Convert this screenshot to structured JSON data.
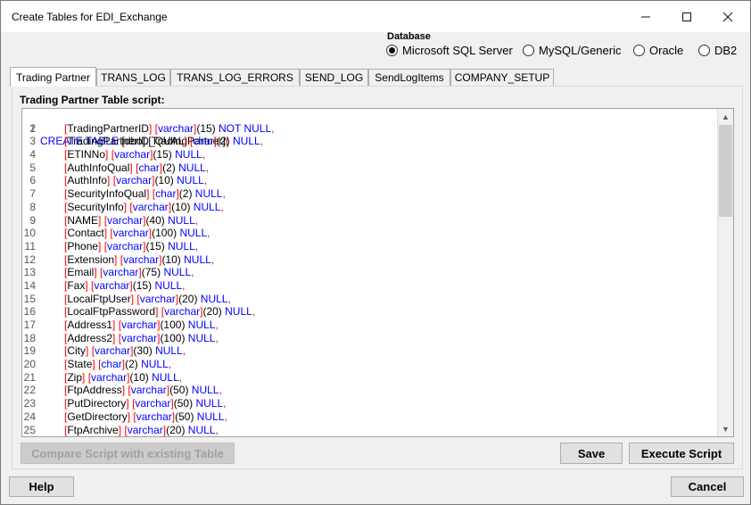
{
  "window": {
    "title": "Create Tables for EDI_Exchange",
    "minimize_icon": "minimize-icon",
    "maximize_icon": "maximize-icon",
    "close_icon": "close-icon"
  },
  "database": {
    "label": "Database",
    "options": [
      "Microsoft SQL Server",
      "MySQL/Generic",
      "Oracle",
      "DB2"
    ],
    "selected": "Microsoft SQL Server"
  },
  "tabs": [
    {
      "label": "Trading Partner",
      "active": true
    },
    {
      "label": "TRANS_LOG",
      "active": false
    },
    {
      "label": "TRANS_LOG_ERRORS",
      "active": false
    },
    {
      "label": "SEND_LOG",
      "active": false
    },
    {
      "label": "SendLogItems",
      "active": false
    },
    {
      "label": "COMPANY_SETUP",
      "active": false
    }
  ],
  "script_label": "Trading Partner Table script:",
  "script_header": {
    "kw": "CREATE TABLE",
    "schema": "[dbo]",
    "table": "[TradingPartner]",
    "paren": "("
  },
  "script_lines": [
    {
      "n": "2",
      "col": "TradingPartnerID",
      "type": "varchar",
      "size": "15",
      "nn": "NOT NULL"
    },
    {
      "n": "3",
      "col": "TradingPartnerID_QUAL",
      "type": "char",
      "size": "2",
      "nn": "NULL"
    },
    {
      "n": "4",
      "col": "ETINNo",
      "type": "varchar",
      "size": "15",
      "nn": "NULL"
    },
    {
      "n": "5",
      "col": "AuthInfoQual",
      "type": "char",
      "size": "2",
      "nn": "NULL"
    },
    {
      "n": "6",
      "col": "AuthInfo",
      "type": "varchar",
      "size": "10",
      "nn": "NULL"
    },
    {
      "n": "7",
      "col": "SecurityInfoQual",
      "type": "char",
      "size": "2",
      "nn": "NULL"
    },
    {
      "n": "8",
      "col": "SecurityInfo",
      "type": "varchar",
      "size": "10",
      "nn": "NULL"
    },
    {
      "n": "9",
      "col": "NAME",
      "type": "varchar",
      "size": "40",
      "nn": "NULL"
    },
    {
      "n": "10",
      "col": "Contact",
      "type": "varchar",
      "size": "100",
      "nn": "NULL"
    },
    {
      "n": "11",
      "col": "Phone",
      "type": "varchar",
      "size": "15",
      "nn": "NULL"
    },
    {
      "n": "12",
      "col": "Extension",
      "type": "varchar",
      "size": "10",
      "nn": "NULL"
    },
    {
      "n": "13",
      "col": "Email",
      "type": "varchar",
      "size": "75",
      "nn": "NULL"
    },
    {
      "n": "14",
      "col": "Fax",
      "type": "varchar",
      "size": "15",
      "nn": "NULL"
    },
    {
      "n": "15",
      "col": "LocalFtpUser",
      "type": "varchar",
      "size": "20",
      "nn": "NULL"
    },
    {
      "n": "16",
      "col": "LocalFtpPassword",
      "type": "varchar",
      "size": "20",
      "nn": "NULL"
    },
    {
      "n": "17",
      "col": "Address1",
      "type": "varchar",
      "size": "100",
      "nn": "NULL"
    },
    {
      "n": "18",
      "col": "Address2",
      "type": "varchar",
      "size": "100",
      "nn": "NULL"
    },
    {
      "n": "19",
      "col": "City",
      "type": "varchar",
      "size": "30",
      "nn": "NULL"
    },
    {
      "n": "20",
      "col": "State",
      "type": "char",
      "size": "2",
      "nn": "NULL"
    },
    {
      "n": "21",
      "col": "Zip",
      "type": "varchar",
      "size": "10",
      "nn": "NULL"
    },
    {
      "n": "22",
      "col": "FtpAddress",
      "type": "varchar",
      "size": "50",
      "nn": "NULL"
    },
    {
      "n": "23",
      "col": "PutDirectory",
      "type": "varchar",
      "size": "50",
      "nn": "NULL"
    },
    {
      "n": "24",
      "col": "GetDirectory",
      "type": "varchar",
      "size": "50",
      "nn": "NULL"
    },
    {
      "n": "25",
      "col": "FtpArchive",
      "type": "varchar",
      "size": "20",
      "nn": "NULL"
    }
  ],
  "buttons": {
    "compare": "Compare Script with existing Table",
    "save": "Save",
    "execute": "Execute Script",
    "help": "Help",
    "cancel": "Cancel"
  },
  "colors": {
    "keyword": "#0000ff",
    "bracket": "#ff0000",
    "window_bg": "#f0f0f0"
  }
}
